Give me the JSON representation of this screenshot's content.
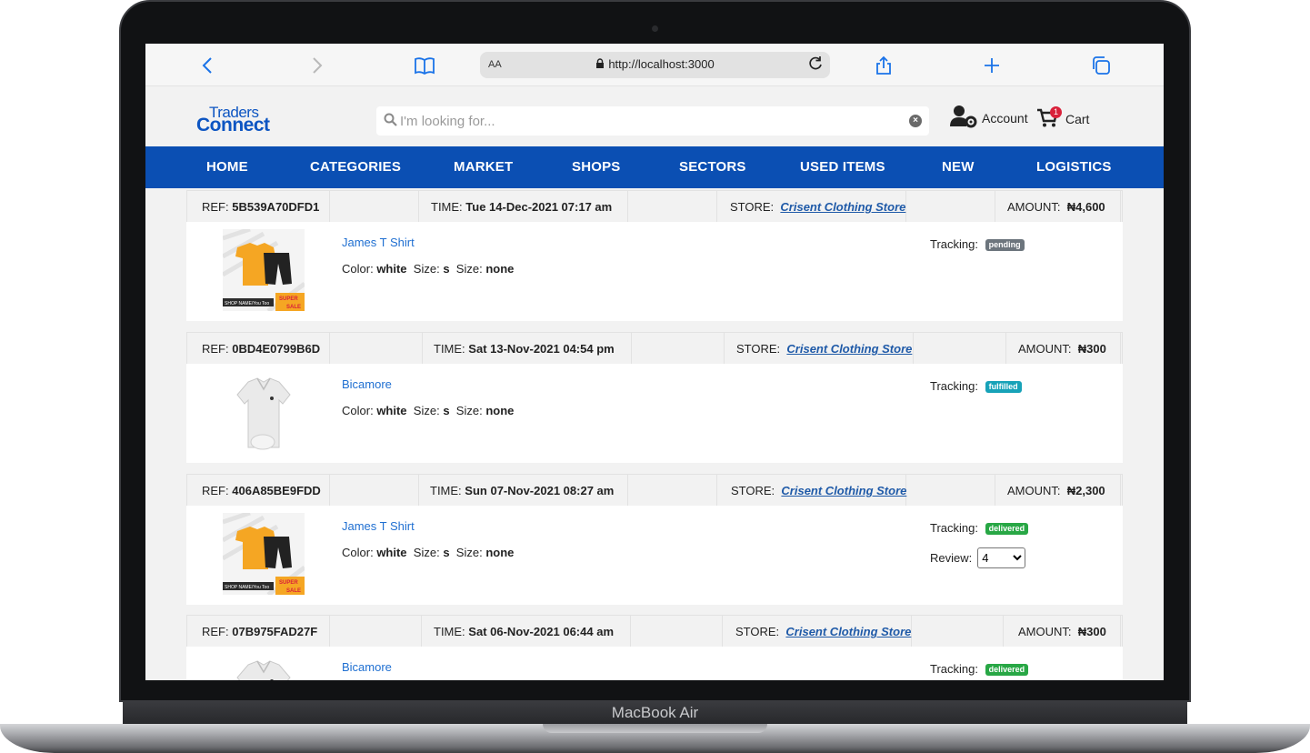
{
  "device": {
    "brand_label": "MacBook Air"
  },
  "browser": {
    "url_aa": "AA",
    "url": "http://localhost:3000"
  },
  "site": {
    "logo_top": "Traders",
    "logo_bottom": "Connect",
    "search_placeholder": "I'm looking for...",
    "account_label": "Account",
    "cart_label": "Cart",
    "cart_count": "1"
  },
  "nav": [
    "HOME",
    "CATEGORIES",
    "MARKET",
    "SHOPS",
    "SECTORS",
    "USED ITEMS",
    "NEW",
    "LOGISTICS"
  ],
  "labels": {
    "ref": "REF:",
    "time": "TIME:",
    "store": "STORE:",
    "amount": "AMOUNT:",
    "color": "Color:",
    "size": "Size:",
    "tracking": "Tracking:",
    "review": "Review:"
  },
  "orders": [
    {
      "ref": "5B539A70DFD1",
      "time": "Tue 14-Dec-2021 07:17 am",
      "store": "Crisent Clothing Store",
      "amount": "₦4,600",
      "item_name": "James T Shirt",
      "color": "white",
      "size1": "s",
      "size2": "none",
      "tracking": "pending",
      "tracking_color": "#6c757d",
      "image": "tshirt-shorts-icon"
    },
    {
      "ref": "0BD4E0799B6D",
      "time": "Sat 13-Nov-2021 04:54 pm",
      "store": "Crisent Clothing Store",
      "amount": "₦300",
      "item_name": "Bicamore",
      "color": "white",
      "size1": "s",
      "size2": "none",
      "tracking": "fulfilled",
      "tracking_color": "#17a2b8",
      "image": "polo-shirt-icon"
    },
    {
      "ref": "406A85BE9FDD",
      "time": "Sun 07-Nov-2021 08:27 am",
      "store": "Crisent Clothing Store",
      "amount": "₦2,300",
      "item_name": "James T Shirt",
      "color": "white",
      "size1": "s",
      "size2": "none",
      "tracking": "delivered",
      "tracking_color": "#28a745",
      "review": "4",
      "image": "tshirt-shorts-icon"
    },
    {
      "ref": "07B975FAD27F",
      "time": "Sat 06-Nov-2021 06:44 am",
      "store": "Crisent Clothing Store",
      "amount": "₦300",
      "item_name": "Bicamore",
      "tracking": "delivered",
      "tracking_color": "#28a745",
      "image": "polo-shirt-icon"
    }
  ],
  "thumb_text": {
    "shop_name": "SHOP NAME/You Too",
    "super": "SUPER",
    "sale": "SALE"
  }
}
